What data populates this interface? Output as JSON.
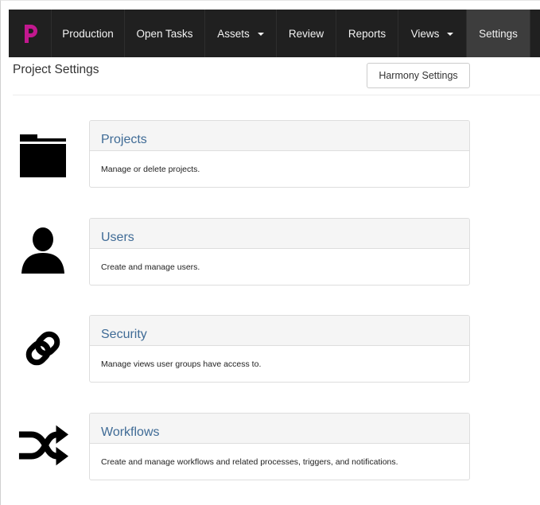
{
  "navbar": {
    "brand_letter": "p",
    "brand_color": "#c2188f",
    "items": [
      {
        "label": "Production",
        "dropdown": false,
        "active": false
      },
      {
        "label": "Open Tasks",
        "dropdown": false,
        "active": false
      },
      {
        "label": "Assets",
        "dropdown": true,
        "active": false
      },
      {
        "label": "Review",
        "dropdown": false,
        "active": false
      },
      {
        "label": "Reports",
        "dropdown": false,
        "active": false
      },
      {
        "label": "Views",
        "dropdown": true,
        "active": false
      },
      {
        "label": "Settings",
        "dropdown": false,
        "active": true
      }
    ]
  },
  "header": {
    "title": "Project Settings",
    "harmony_button": "Harmony Settings"
  },
  "settings": [
    {
      "title": "Projects",
      "description": "Manage or delete projects.",
      "icon": "folder-icon"
    },
    {
      "title": "Users",
      "description": "Create and manage users.",
      "icon": "user-icon"
    },
    {
      "title": "Security",
      "description": "Manage views user groups have access to.",
      "icon": "link-icon"
    },
    {
      "title": "Workflows",
      "description": "Create and manage workflows and related processes, triggers, and notifications.",
      "icon": "shuffle-icon"
    }
  ],
  "colors": {
    "navbar_bg": "#202020",
    "navbar_active": "#3d3d3d",
    "panel_title": "#3f6b96",
    "panel_heading_bg": "#f5f5f5"
  }
}
